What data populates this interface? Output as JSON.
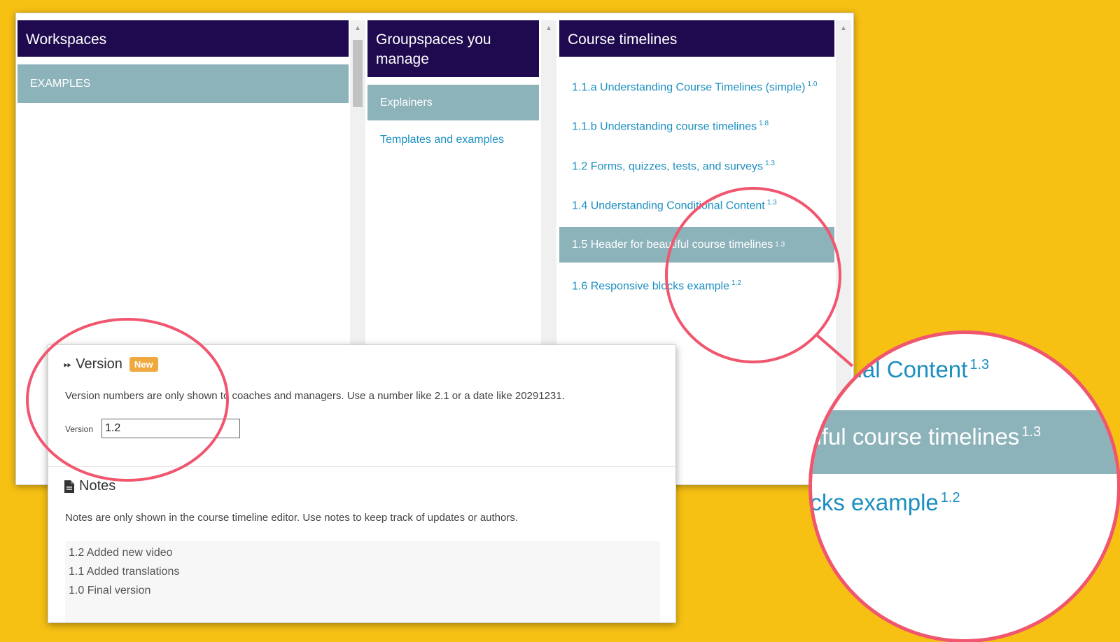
{
  "columns": {
    "workspaces": {
      "title": "Workspaces",
      "selected": "EXAMPLES"
    },
    "groupspaces": {
      "title": "Groupspaces you manage",
      "selected": "Explainers",
      "items": [
        "Templates and examples"
      ]
    },
    "course_timelines": {
      "title": "Course timelines",
      "items": [
        {
          "label": "1.1.a Understanding Course Timelines (simple)",
          "version": "1.0",
          "active": false
        },
        {
          "label": "1.1.b Understanding course timelines",
          "version": "1.8",
          "active": false
        },
        {
          "label": "1.2 Forms, quizzes, tests, and surveys",
          "version": "1.3",
          "active": false
        },
        {
          "label": "1.4 Understanding Conditional Content",
          "version": "1.3",
          "active": false
        },
        {
          "label": "1.5 Header for beautiful course timelines",
          "version": "1.3",
          "active": true
        },
        {
          "label": "1.6 Responsive blocks example",
          "version": "1.2",
          "active": false
        }
      ]
    }
  },
  "version_section": {
    "title": "Version",
    "badge": "New",
    "help": "Version numbers are only shown to coaches and managers. Use a number like 2.1 or a date like 20291231.",
    "field_label": "Version",
    "field_value": "1.2"
  },
  "notes_section": {
    "title": "Notes",
    "help": "Notes are only shown in the course timeline editor. Use notes to keep track of updates or authors.",
    "lines": [
      "1.2 Added new video",
      "1.1 Added translations",
      "1.0 Final version"
    ]
  },
  "magnifier": {
    "line1": "ditional Content",
    "line1_version": "1.3",
    "line2": "utiful course timelines",
    "line2_version": "1.3",
    "line3": "ocks example",
    "line3_version": "1.2"
  },
  "colors": {
    "background": "#F7C114",
    "header": "#1F0A4F",
    "selected": "#8CB2BA",
    "link": "#1C8FBF",
    "annotation": "#F0566E",
    "badge": "#F0A93E"
  }
}
